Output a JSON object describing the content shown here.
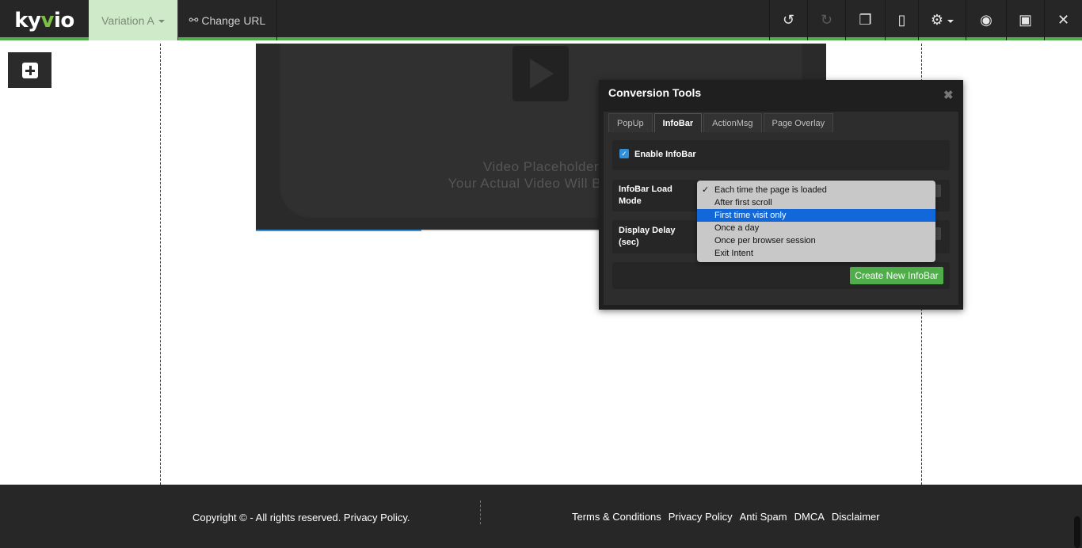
{
  "toolbar": {
    "logo_prefix": "ky",
    "logo_accent": "v",
    "logo_suffix": "io",
    "variation_label": "Variation A",
    "change_url_label": "Change URL",
    "tools": [
      {
        "icon": "undo-icon",
        "glyph": "↺",
        "enabled": true
      },
      {
        "icon": "redo-icon",
        "glyph": "↻",
        "enabled": false
      },
      {
        "icon": "copy-icon",
        "glyph": "❐",
        "enabled": true
      },
      {
        "icon": "mobile-icon",
        "glyph": "▯",
        "enabled": true
      },
      {
        "icon": "gear-icon",
        "glyph": "⚙",
        "enabled": true
      },
      {
        "icon": "eye-icon",
        "glyph": "◉",
        "enabled": true
      },
      {
        "icon": "save-icon",
        "glyph": "▣",
        "enabled": true
      },
      {
        "icon": "close-icon",
        "glyph": "✕",
        "enabled": true
      }
    ],
    "accent_color": "#4fae4a"
  },
  "video": {
    "placeholder_line1": "Video Placeholder",
    "placeholder_line2": "Your Actual Video Will Be Dis",
    "progress_fraction": 0.29
  },
  "footer": {
    "copyright": "Copyright © - All rights reserved. Privacy Policy.",
    "links": [
      "Terms & Conditions",
      "Privacy Policy",
      "Anti Spam",
      "DMCA",
      "Disclaimer"
    ]
  },
  "conversion_tools": {
    "title": "Conversion Tools",
    "close_glyph": "✖",
    "tabs": [
      {
        "label": "PopUp",
        "active": false
      },
      {
        "label": "InfoBar",
        "active": true
      },
      {
        "label": "ActionMsg",
        "active": false
      },
      {
        "label": "Page Overlay",
        "active": false
      }
    ],
    "enable_label": "Enable InfoBar",
    "enable_checked": true,
    "load_mode_label_1": "InfoBar Load",
    "load_mode_label_2": "Mode",
    "delay_label_1": "Display Delay",
    "delay_label_2": "(sec)",
    "create_button": "Create New InfoBar"
  },
  "load_mode_options": [
    {
      "label": "Each time the page is loaded",
      "checked": true,
      "highlighted": false
    },
    {
      "label": "After first scroll",
      "checked": false,
      "highlighted": false
    },
    {
      "label": "First time visit only",
      "checked": false,
      "highlighted": true
    },
    {
      "label": "Once a day",
      "checked": false,
      "highlighted": false
    },
    {
      "label": "Once per browser session",
      "checked": false,
      "highlighted": false
    },
    {
      "label": "Exit Intent",
      "checked": false,
      "highlighted": false
    }
  ],
  "check_glyph": "✓"
}
